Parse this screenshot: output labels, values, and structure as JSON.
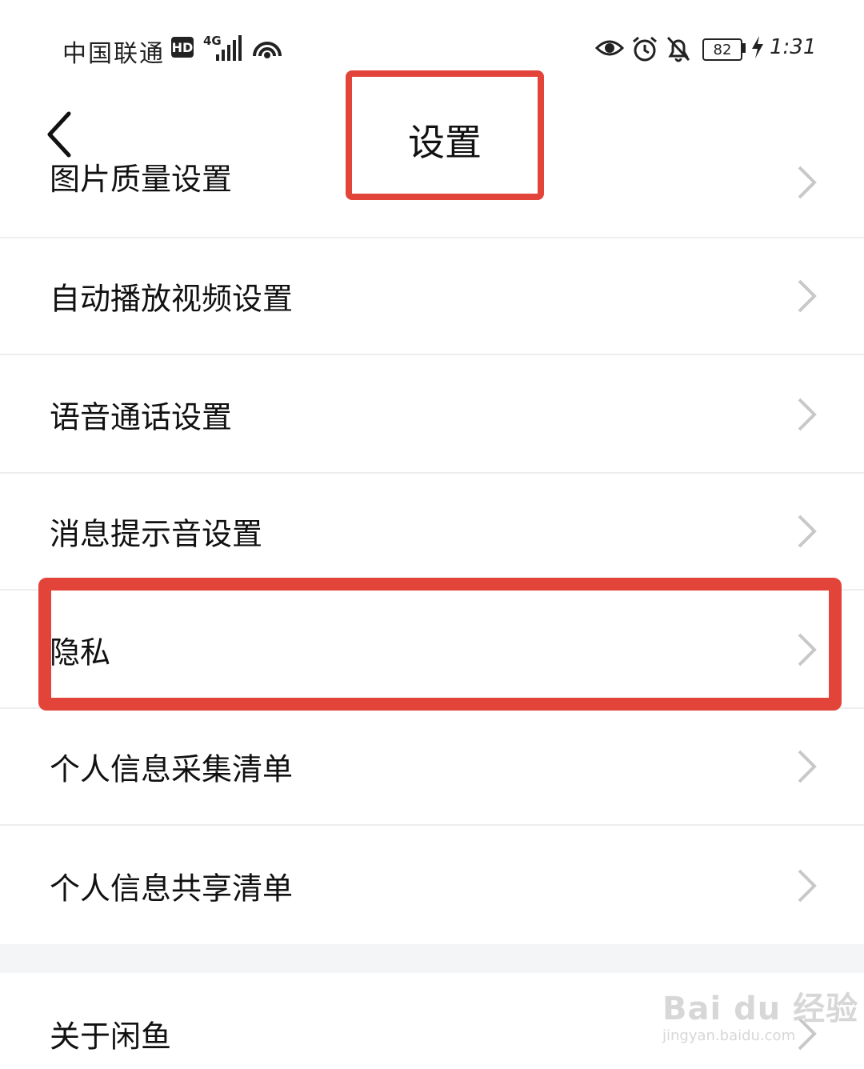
{
  "status_bar": {
    "carrier": "中国联通",
    "hd_badge": "HD",
    "network_type": "4G",
    "battery_level": "82",
    "time": "1:31"
  },
  "header": {
    "back_icon": "chevron-left-icon",
    "title": "设置"
  },
  "settings_items": [
    {
      "label": "图片质量设置"
    },
    {
      "label": "自动播放视频设置"
    },
    {
      "label": "语音通话设置"
    },
    {
      "label": "消息提示音设置"
    },
    {
      "label": "隐私"
    },
    {
      "label": "个人信息采集清单"
    },
    {
      "label": "个人信息共享清单"
    }
  ],
  "about_item": {
    "label": "关于闲鱼"
  },
  "watermark": {
    "text": "Bai du 经验",
    "url": "jingyan.baidu.com"
  },
  "colors": {
    "highlight": "#e3443a",
    "chevron": "#c8c8c8",
    "divider": "#eeeeee",
    "section_gap": "#f4f5f7"
  }
}
